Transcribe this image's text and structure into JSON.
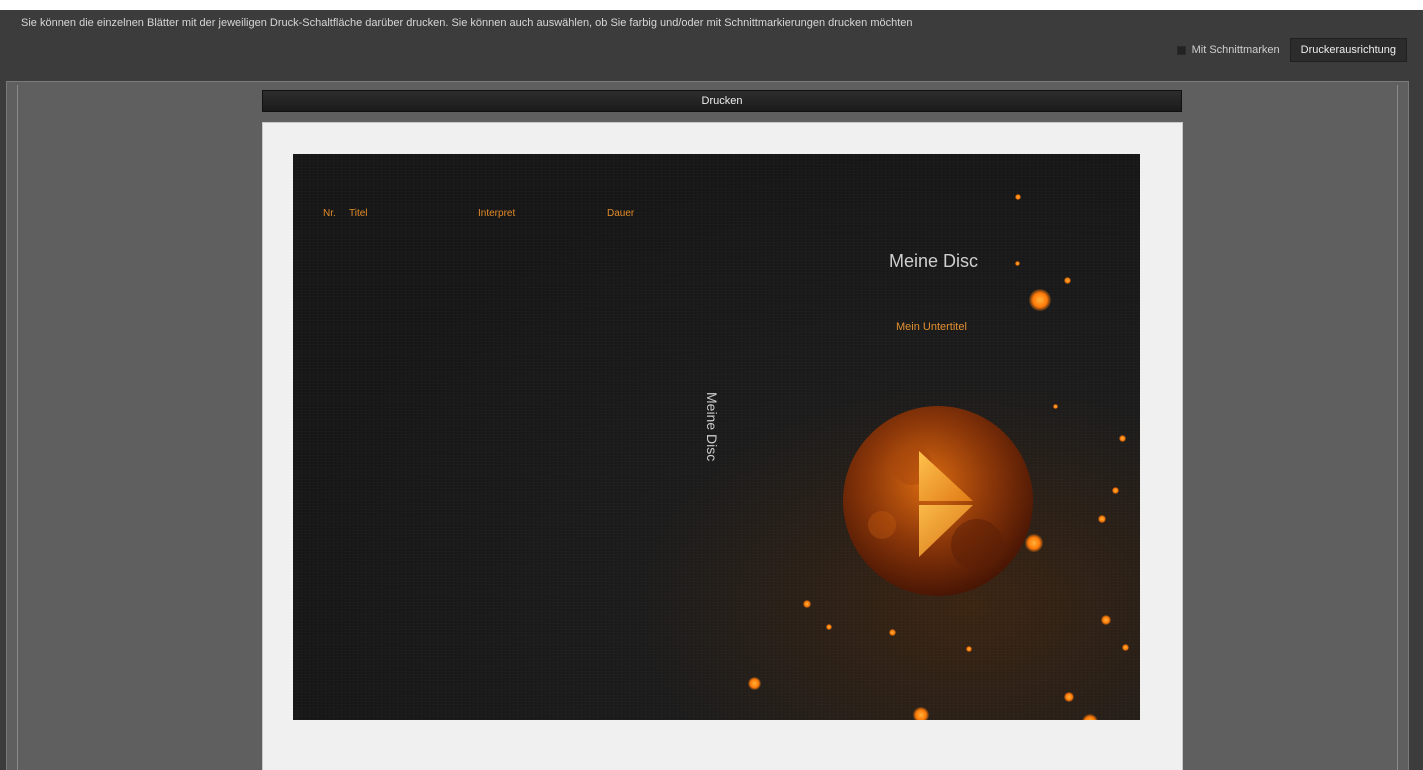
{
  "instruction": "Sie können die einzelnen Blätter mit der jeweiligen Druck-Schaltfläche darüber drucken. Sie können auch auswählen, ob Sie farbig und/oder mit Schnittmarkierungen drucken möchten",
  "options": {
    "cut_marks_label": "Mit Schnittmarken",
    "cut_marks_checked": false,
    "printer_orientation_label": "Druckerausrichtung"
  },
  "print_button_label": "Drucken",
  "cover": {
    "track_headers": {
      "nr": "Nr.",
      "title": "Titel",
      "artist": "Interpret",
      "duration": "Dauer"
    },
    "disc_title": "Meine Disc",
    "disc_subtitle": "Mein Untertitel",
    "spine_title": "Meine Disc",
    "logo_icon": "play-logo-icon",
    "colors": {
      "accent_orange": "#e38b28",
      "cover_background": "#1b1b1b"
    }
  }
}
